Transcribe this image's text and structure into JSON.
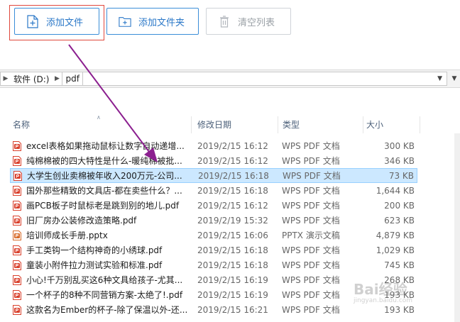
{
  "toolbar": {
    "add_file": "添加文件",
    "add_folder": "添加文件夹",
    "clear_list": "清空列表"
  },
  "address": {
    "drive": "软件 (D:)",
    "folder": "pdf"
  },
  "columns": {
    "name": "名称",
    "date": "修改日期",
    "type": "类型",
    "size": "大小"
  },
  "files": [
    {
      "name": "excel表格如果拖动鼠标让数字自动递增...",
      "date": "2019/2/15 16:12",
      "type": "WPS PDF 文档",
      "size": "300 KB",
      "icon": "pdf"
    },
    {
      "name": "纯棉棉被的四大特性是什么-暖纯棉被批...",
      "date": "2019/2/15 16:12",
      "type": "WPS PDF 文档",
      "size": "346 KB",
      "icon": "pdf"
    },
    {
      "name": "大学生创业卖棉被年收入200万元-公司...",
      "date": "2019/2/15 16:18",
      "type": "WPS PDF 文档",
      "size": "73 KB",
      "icon": "pdf"
    },
    {
      "name": "国外那些精致的文具店-都在卖些什么？...",
      "date": "2019/2/15 16:18",
      "type": "WPS PDF 文档",
      "size": "1,644 KB",
      "icon": "pdf"
    },
    {
      "name": "画PCB板子时鼠标老是跳到别的地儿.pdf",
      "date": "2019/2/15 16:12",
      "type": "WPS PDF 文档",
      "size": "200 KB",
      "icon": "pdf"
    },
    {
      "name": "旧厂房办公装修改造策略.pdf",
      "date": "2019/2/19 15:32",
      "type": "WPS PDF 文档",
      "size": "623 KB",
      "icon": "pdf"
    },
    {
      "name": "培训师成长手册.pptx",
      "date": "2019/2/15 16:06",
      "type": "PPTX 演示文稿",
      "size": "4,879 KB",
      "icon": "pptx"
    },
    {
      "name": "手工类钩一个结构神奇的小绣球.pdf",
      "date": "2019/2/15 16:18",
      "type": "WPS PDF 文档",
      "size": "1,029 KB",
      "icon": "pdf"
    },
    {
      "name": "童装小附件拉力测试实验和标准.pdf",
      "date": "2019/2/15 16:18",
      "type": "WPS PDF 文档",
      "size": "745 KB",
      "icon": "pdf"
    },
    {
      "name": "小心!千万别乱买这6种文具给孩子-尤其...",
      "date": "2019/2/15 16:19",
      "type": "WPS PDF 文档",
      "size": "268 KB",
      "icon": "pdf"
    },
    {
      "name": "一个杯子的8种不同营销方案-太绝了!.pdf",
      "date": "2019/2/15 16:19",
      "type": "WPS PDF 文档",
      "size": "193 KB",
      "icon": "pdf"
    },
    {
      "name": "这款名为Ember的杯子-除了保温以外-还...",
      "date": "2019/2/15 16:21",
      "type": "WPS PDF 文档",
      "size": "193 KB",
      "icon": "pdf"
    }
  ],
  "selected_index": 2,
  "colors": {
    "accent": "#2b78c8",
    "highlight_box": "#e0473c",
    "arrow": "#8b1f8f",
    "selection": "#cce8ff",
    "pdf_icon": "#d9412d",
    "pptx_icon": "#d86b2a"
  },
  "watermark": {
    "text": "Bai经验",
    "sub": "jingyan.baidu.com"
  }
}
